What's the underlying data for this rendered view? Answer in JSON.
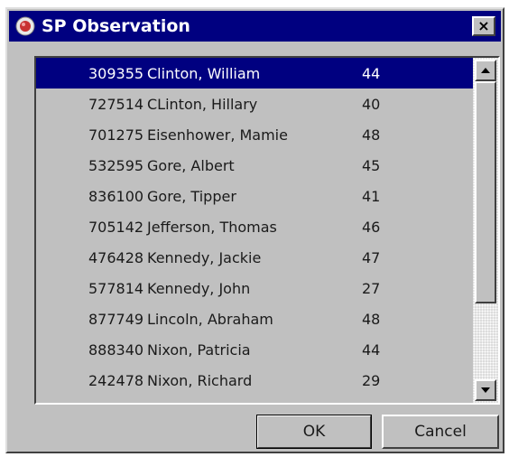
{
  "window": {
    "title": "SP Observation",
    "close_label": "×"
  },
  "list": {
    "selected_index": 0,
    "rows": [
      {
        "id": "309355",
        "name": "Clinton, William",
        "value": "44"
      },
      {
        "id": "727514",
        "name": "CLinton, Hillary",
        "value": "40"
      },
      {
        "id": "701275",
        "name": "Eisenhower, Mamie",
        "value": "48"
      },
      {
        "id": "532595",
        "name": "Gore, Albert",
        "value": "45"
      },
      {
        "id": "836100",
        "name": "Gore, Tipper",
        "value": "41"
      },
      {
        "id": "705142",
        "name": "Jefferson, Thomas",
        "value": "46"
      },
      {
        "id": "476428",
        "name": "Kennedy, Jackie",
        "value": "47"
      },
      {
        "id": "577814",
        "name": "Kennedy, John",
        "value": "27"
      },
      {
        "id": "877749",
        "name": "Lincoln, Abraham",
        "value": "48"
      },
      {
        "id": "888340",
        "name": "Nixon, Patricia",
        "value": "44"
      },
      {
        "id": "242478",
        "name": "Nixon, Richard",
        "value": "29"
      }
    ]
  },
  "buttons": {
    "ok_label": "OK",
    "cancel_label": "Cancel"
  },
  "icons": {
    "app": "app-icon",
    "scroll_up": "arrow-up-icon",
    "scroll_down": "arrow-down-icon"
  },
  "colors": {
    "titlebar": "#000080",
    "selection": "#000080",
    "face": "#c0c0c0"
  }
}
